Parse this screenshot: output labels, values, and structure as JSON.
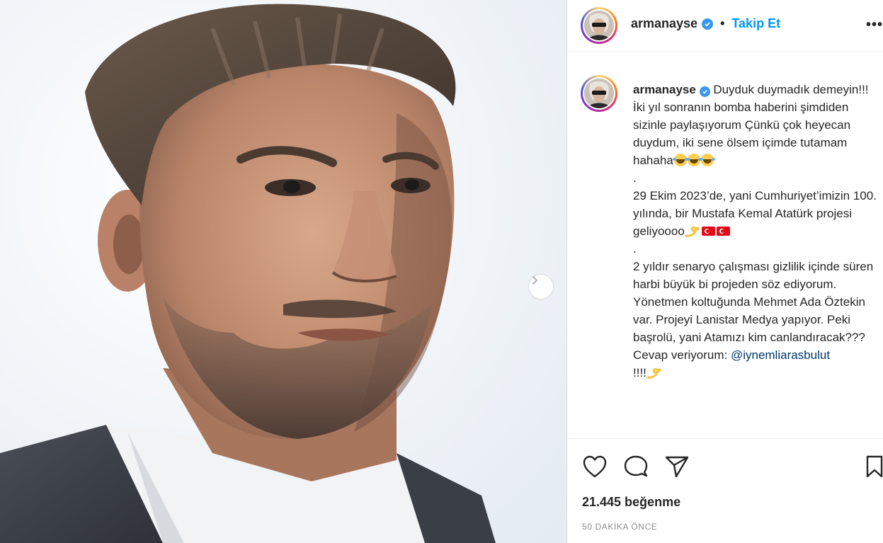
{
  "post": {
    "username": "armanayse",
    "follow_label": "Takip Et",
    "separator": "•",
    "more_label": "•••",
    "caption": {
      "line1": "Duyduk duymadık demeyin!!! İki yıl sonranın bomba haberini şimdiden sizinle paylaşıyorum Çünkü çok heyecan duydum, iki sene ölsem içimde tutamam hahaha",
      "dot1": ".",
      "line2": "29 Ekim 2023’de, yani Cumhuriyet’imizin 100. yılında, bir Mustafa Kemal Atatürk projesi geliyoooo",
      "dot2": ".",
      "line3": "2 yıldır senaryo çalışması gizlilik içinde süren harbi büyük bi projeden söz ediyorum. Yönetmen koltuğunda Mehmet Ada Öztekin var. Projeyi Lanistar Medya yapıyor. Peki başrolü, yani Atamızı kim canlandıracak??? Cevap veriyorum:",
      "mention": "@iynemliarasbulut",
      "tail": "!!!!"
    },
    "likes": "21.445 beğenme",
    "time_ago": "50 DAKİKA ÖNCE"
  },
  "icons": {
    "like": "heart-icon",
    "comment": "comment-icon",
    "share": "paper-plane-icon",
    "save": "bookmark-icon",
    "next": "chevron-right-icon",
    "verified": "verified-badge-icon"
  },
  "colors": {
    "accent": "#0095f6",
    "mention": "#00376b",
    "verified": "#3897f0",
    "muted": "#8e8e8e"
  }
}
